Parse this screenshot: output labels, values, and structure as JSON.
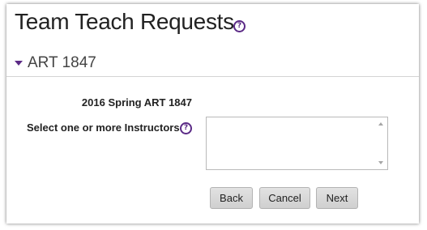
{
  "page": {
    "title": "Team Teach Requests",
    "help_glyph": "?"
  },
  "section": {
    "label": "ART 1847",
    "icon": "caret-down-icon"
  },
  "form": {
    "term_course": "2016 Spring ART 1847",
    "instructors_label": "Select one or more Instructors",
    "help_glyph": "?",
    "instructors_selected": []
  },
  "buttons": {
    "back": "Back",
    "cancel": "Cancel",
    "next": "Next"
  },
  "colors": {
    "accent": "#5b2a86",
    "button_bg": "#d9d9d9",
    "divider": "#d4d4d4"
  }
}
